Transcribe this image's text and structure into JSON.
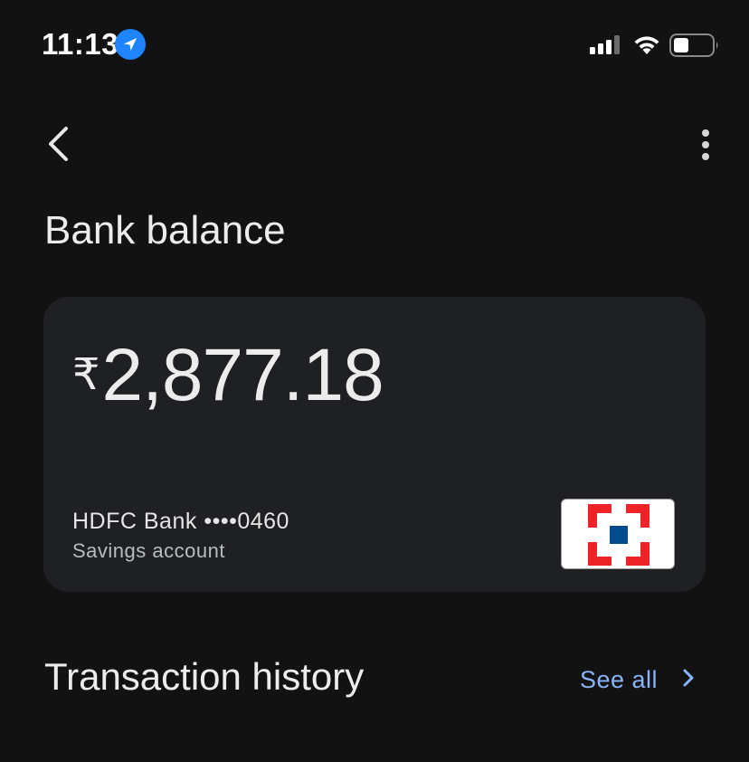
{
  "status_bar": {
    "time": "11:13"
  },
  "page": {
    "title": "Bank balance"
  },
  "balance_card": {
    "currency_symbol": "₹",
    "amount": "2,877.18",
    "bank_name": "HDFC Bank",
    "masked_account": "••••0460",
    "account_type": "Savings account"
  },
  "transactions": {
    "title": "Transaction history",
    "see_all_label": "See all"
  },
  "colors": {
    "background": "#121212",
    "card": "#1f2023",
    "link": "#8ab4f8",
    "location_badge": "#1e84ff",
    "hdfc_red": "#ed232a",
    "hdfc_blue": "#004c8f"
  },
  "icons": {
    "location": "location-arrow-icon",
    "signal": "cellular-signal-icon",
    "wifi": "wifi-icon",
    "battery": "battery-icon",
    "back": "chevron-left-icon",
    "more": "more-vert-icon",
    "see_all": "chevron-right-icon",
    "bank_logo": "hdfc-logo-icon"
  }
}
